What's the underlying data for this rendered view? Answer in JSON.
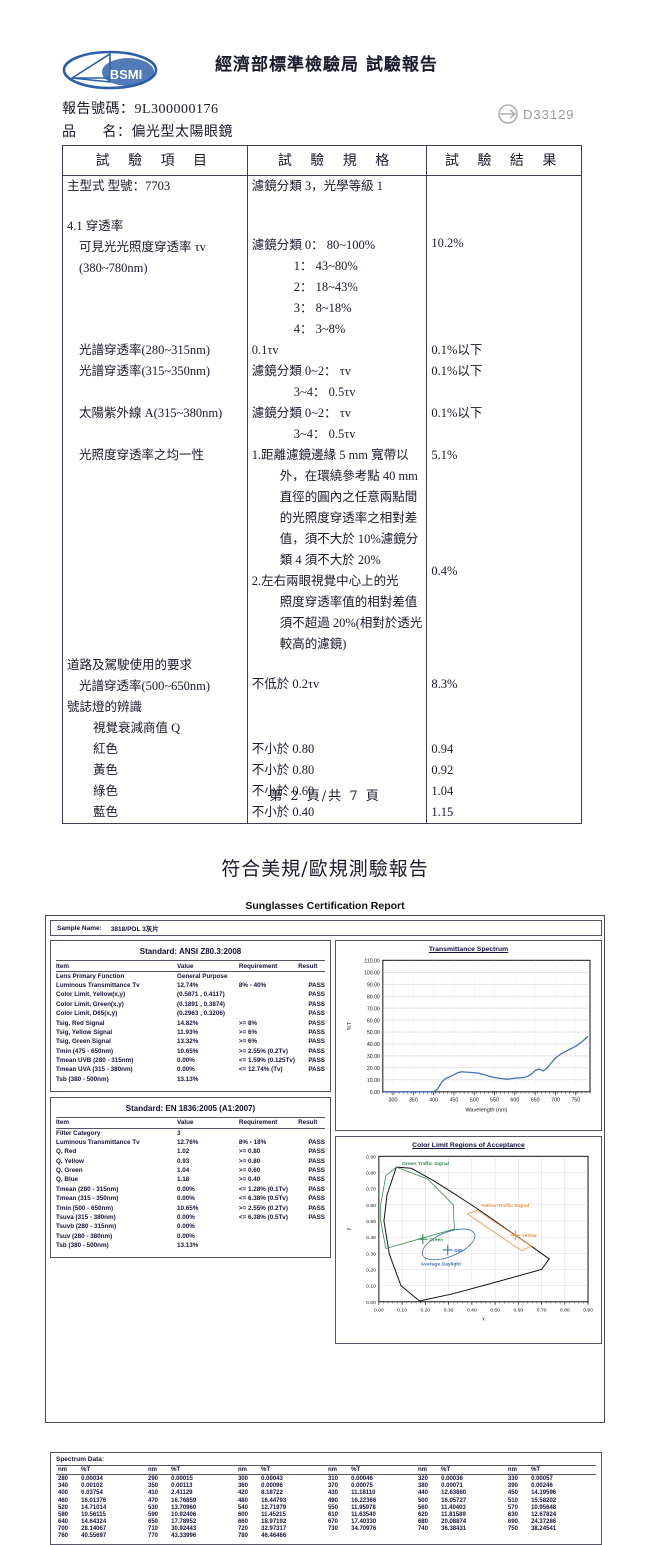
{
  "page1": {
    "header_title": "經濟部標準檢驗局 試驗報告",
    "logo_text": "BSMI",
    "report_no_label": "報告號碼：",
    "report_no": "9L300000176",
    "product_label_1": "品",
    "product_label_2": "名：",
    "product_name": "偏光型太陽眼鏡",
    "d_mark": "D33129",
    "columns": [
      "試 驗 項 目",
      "試 驗 規 格",
      "試 驗 結 果"
    ],
    "rows": {
      "model_item": "主型式 型號：7703",
      "model_spec": "濾鏡分類 3，光學等級 1",
      "sec41": "4.1 穿透率",
      "tv_item_1": "可見光光照度穿透率 τv",
      "tv_item_2": "(380~780nm)",
      "tv_spec_0": "濾鏡分類 0： 80~100%",
      "tv_spec_1": "1： 43~80%",
      "tv_spec_2": "2： 18~43%",
      "tv_spec_3": "3： 8~18%",
      "tv_spec_4": "4： 3~8%",
      "tv_result": "10.2%",
      "uv280_item": "光譜穿透率(280~315nm)",
      "uv280_spec": "0.1τv",
      "uv280_result": "0.1%以下",
      "uv315_item": "光譜穿透率(315~350nm)",
      "uv315_spec_1": "濾鏡分類 0~2： τv",
      "uv315_spec_2": "3~4： 0.5τv",
      "uv315_result": "0.1%以下",
      "uva_item": "太陽紫外線 A(315~380nm)",
      "uva_spec_1": "濾鏡分類 0~2： τv",
      "uva_spec_2": "3~4： 0.5τv",
      "uva_result": "0.1%以下",
      "unif_item": "光照度穿透率之均一性",
      "unif_spec_1a": "1.距離濾鏡邊緣 5 mm 寬帶以",
      "unif_spec_1b": "外，在環繞參考點 40 mm",
      "unif_spec_1c": "直徑的圓內之任意兩點間",
      "unif_spec_1d": "的光照度穿透率之相對差",
      "unif_spec_1e": "值，須不大於 10%濾鏡分",
      "unif_spec_1f": "類 4 須不大於 20%",
      "unif_result_1": "5.1%",
      "unif_spec_2a": "2.左右兩眼視覺中心上的光",
      "unif_spec_2b": "照度穿透率值的相對差值",
      "unif_spec_2c": "須不超過 20%(相對於透光",
      "unif_spec_2d": "較高的濾鏡)",
      "unif_result_2": "0.4%",
      "road_item": "道路及駕駛使用的要求",
      "road_sub_item": "光譜穿透率(500~650nm)",
      "road_spec": "不低於 0.2τv",
      "road_result": "8.3%",
      "signal_item": "號誌燈的辨識",
      "q_item": "視覺衰減商值 Q",
      "red_item": "紅色",
      "red_spec": "不小於 0.80",
      "red_result": "0.94",
      "yellow_item": "黃色",
      "yellow_spec": "不小於 0.80",
      "yellow_result": "0.92",
      "green_item": "綠色",
      "green_spec": "不小於 0.60",
      "green_result": "1.04",
      "blue_item": "藍色",
      "blue_spec": "不小於 0.40",
      "blue_result": "1.15"
    },
    "footer": "第 2 頁/共 7 頁"
  },
  "page2": {
    "title": "符合美規/歐規測驗報告",
    "subtitle": "Sunglasses Certification Report",
    "sample_label": "Sample Name:",
    "sample_value": "3818/POL 3灰片",
    "ansi": {
      "heading": "Standard: ANSI Z80.3:2008",
      "columns": [
        "Item",
        "Value",
        "Requirement",
        "Result"
      ],
      "rows": [
        [
          "Lens Primary Function",
          "General Purpose",
          "",
          ""
        ],
        [
          "Luminous Transmittance Tv",
          "12.74%",
          "8% - 40%",
          "PASS"
        ],
        [
          "Color Limit, Yellow(x,y)",
          "(0.5871 , 0.4117)",
          "",
          "PASS"
        ],
        [
          "Color Limit, Green(x,y)",
          "(0.1891 , 0.3874)",
          "",
          "PASS"
        ],
        [
          "Color Limit, D65(x,y)",
          "(0.2963 , 0.3206)",
          "",
          "PASS"
        ],
        [
          "Tsig, Red Signal",
          "14.82%",
          ">= 8%",
          "PASS"
        ],
        [
          "Tsig, Yellow Signal",
          "11.93%",
          ">= 6%",
          "PASS"
        ],
        [
          "Tsig, Green Signal",
          "13.32%",
          ">= 6%",
          "PASS"
        ],
        [
          "Tmin (475 - 650nm)",
          "10.65%",
          ">= 2.55% (0.2Tv)",
          "PASS"
        ],
        [
          "Tmean UVB (280 - 315nm)",
          "0.00%",
          "<= 1.59% (0.125Tv)",
          "PASS"
        ],
        [
          "Tmean UVA (315 - 380nm)",
          "0.00%",
          "<= 12.74% (Tv)",
          "PASS"
        ],
        [
          "Tsb (380 - 500nm)",
          "13.13%",
          "",
          ""
        ]
      ]
    },
    "en": {
      "heading": "Standard: EN 1836:2005 (A1:2007)",
      "columns": [
        "Item",
        "Value",
        "Requirement",
        "Result"
      ],
      "rows": [
        [
          "Filter Category",
          "3",
          "",
          ""
        ],
        [
          "Luminous Transmittance Tv",
          "12.76%",
          "8% - 18%",
          "PASS"
        ],
        [
          "Q, Red",
          "1.02",
          ">= 0.80",
          "PASS"
        ],
        [
          "Q, Yellow",
          "0.93",
          ">= 0.80",
          "PASS"
        ],
        [
          "Q, Green",
          "1.04",
          ">= 0.60",
          "PASS"
        ],
        [
          "Q, Blue",
          "1.18",
          ">= 0.40",
          "PASS"
        ],
        [
          "Tmean (280 - 315nm)",
          "0.00%",
          "<= 1.28% (0.1Tv)",
          "PASS"
        ],
        [
          "Tmean (315 - 350nm)",
          "0.00%",
          "<= 6.38% (0.5Tv)",
          "PASS"
        ],
        [
          "Tmin (500 - 650nm)",
          "10.65%",
          ">= 2.55% (0.2Tv)",
          "PASS"
        ],
        [
          "Tsuva (315 - 380nm)",
          "0.00%",
          "<= 6.38% (0.5Tv)",
          "PASS"
        ],
        [
          "Tsuvb (280 - 315nm)",
          "0.00%",
          "",
          ""
        ],
        [
          "Tsuv (280 - 380nm)",
          "0.00%",
          "",
          ""
        ],
        [
          "Tsb (380 - 500nm)",
          "13.13%",
          "",
          ""
        ]
      ]
    },
    "spectrum_data": {
      "title": "Spectrum Data:",
      "columns": [
        "nm",
        "%T"
      ],
      "values": [
        [
          280,
          "0.00034"
        ],
        [
          290,
          "0.00015"
        ],
        [
          300,
          "0.00043"
        ],
        [
          310,
          "0.00046"
        ],
        [
          320,
          "0.00036"
        ],
        [
          330,
          "0.00057"
        ],
        [
          340,
          "0.00102"
        ],
        [
          350,
          "0.00113"
        ],
        [
          360,
          "0.00096"
        ],
        [
          370,
          "0.00075"
        ],
        [
          380,
          "0.00071"
        ],
        [
          390,
          "0.00246"
        ],
        [
          400,
          "0.03754"
        ],
        [
          410,
          "2.41129"
        ],
        [
          420,
          "8.18722"
        ],
        [
          430,
          "11.18110"
        ],
        [
          440,
          "12.63860"
        ],
        [
          450,
          "14.19596"
        ],
        [
          460,
          "16.01376"
        ],
        [
          470,
          "16.76859"
        ],
        [
          480,
          "16.44793"
        ],
        [
          490,
          "16.22366"
        ],
        [
          500,
          "16.05727"
        ],
        [
          510,
          "15.58202"
        ],
        [
          520,
          "14.71014"
        ],
        [
          530,
          "13.70960"
        ],
        [
          540,
          "12.71979"
        ],
        [
          550,
          "11.95978"
        ],
        [
          560,
          "11.40403"
        ],
        [
          570,
          "10.95648"
        ],
        [
          580,
          "10.56115"
        ],
        [
          590,
          "10.92406"
        ],
        [
          600,
          "11.45215"
        ],
        [
          610,
          "11.63540"
        ],
        [
          620,
          "11.81589"
        ],
        [
          630,
          "12.67824"
        ],
        [
          640,
          "14.64324"
        ],
        [
          650,
          "17.78952"
        ],
        [
          660,
          "18.97192"
        ],
        [
          670,
          "17.40330"
        ],
        [
          680,
          "20.08874"
        ],
        [
          690,
          "24.37286"
        ],
        [
          700,
          "28.14067"
        ],
        [
          710,
          "30.92443"
        ],
        [
          720,
          "32.97317"
        ],
        [
          730,
          "34.70976"
        ],
        [
          740,
          "36.38431"
        ],
        [
          750,
          "38.24541"
        ],
        [
          760,
          "40.55697"
        ],
        [
          770,
          "43.33996"
        ],
        [
          780,
          "46.46466"
        ]
      ]
    },
    "chart_data": [
      {
        "type": "line",
        "title": "Transmittance Spectrum",
        "xlabel": "Wavelength (nm)",
        "ylabel": "%T",
        "xlim": [
          275,
          785
        ],
        "ylim": [
          0,
          110
        ],
        "xticks": [
          300,
          350,
          400,
          450,
          500,
          550,
          600,
          650,
          700,
          750
        ],
        "yticks": [
          "0.00",
          "10.00",
          "20.00",
          "30.00",
          "40.00",
          "50.00",
          "60.00",
          "70.00",
          "80.00",
          "90.00",
          "100.00",
          "110.00"
        ],
        "grid": true,
        "series_color": "#3d6fb5",
        "x": [
          280,
          290,
          300,
          310,
          320,
          330,
          340,
          350,
          360,
          370,
          380,
          390,
          400,
          410,
          420,
          430,
          440,
          450,
          460,
          470,
          480,
          490,
          500,
          510,
          520,
          530,
          540,
          550,
          560,
          570,
          580,
          590,
          600,
          610,
          620,
          630,
          640,
          650,
          660,
          670,
          680,
          690,
          700,
          710,
          720,
          730,
          740,
          750,
          760,
          770,
          780
        ],
        "y": [
          0.00034,
          0.00015,
          0.00043,
          0.00046,
          0.00036,
          0.00057,
          0.00102,
          0.00113,
          0.00096,
          0.00075,
          0.00071,
          0.00246,
          0.03754,
          2.41129,
          8.18722,
          11.1811,
          12.6386,
          14.19596,
          16.01376,
          16.76859,
          16.44793,
          16.22366,
          16.05727,
          15.58202,
          14.71014,
          13.7096,
          12.71979,
          11.95978,
          11.40403,
          10.95648,
          10.56115,
          10.92406,
          11.45215,
          11.6354,
          11.81589,
          12.67824,
          14.64324,
          17.78952,
          18.97192,
          17.4033,
          20.08874,
          24.37286,
          28.14067,
          30.92443,
          32.97317,
          34.70976,
          36.38431,
          38.24541,
          40.55697,
          43.33996,
          46.46466
        ]
      },
      {
        "type": "scatter",
        "title": "Color Limit Regions of Acceptance",
        "xlabel": "x",
        "ylabel": "y",
        "xlim": [
          0,
          0.9
        ],
        "ylim": [
          0,
          0.9
        ],
        "xticks": [
          "0.00",
          "0.10",
          "0.20",
          "0.30",
          "0.40",
          "0.50",
          "0.60",
          "0.70",
          "0.80",
          "0.90"
        ],
        "yticks": [
          "0.00",
          "0.10",
          "0.20",
          "0.30",
          "0.40",
          "0.50",
          "0.60",
          "0.70",
          "0.80",
          "0.90"
        ],
        "grid": true,
        "annotations": [
          {
            "label": "Green Traffic Signal",
            "color": "#2f8f4e"
          },
          {
            "label": "Yellow Traffic Signal",
            "color": "#f0943c"
          },
          {
            "label": "Average Daylight",
            "color": "#3d6fb5"
          },
          {
            "label": "Green",
            "color": "#2f8f4e"
          },
          {
            "label": "Yellow",
            "color": "#f0943c"
          },
          {
            "label": "D65",
            "color": "#3d6fb5"
          }
        ],
        "points": [
          {
            "name": "Green",
            "x": 0.1891,
            "y": 0.3874,
            "color": "#2f8f4e"
          },
          {
            "name": "Yellow",
            "x": 0.5871,
            "y": 0.4117,
            "color": "#f0943c"
          },
          {
            "name": "D65",
            "x": 0.2963,
            "y": 0.3206,
            "color": "#3d6fb5"
          }
        ]
      }
    ]
  }
}
